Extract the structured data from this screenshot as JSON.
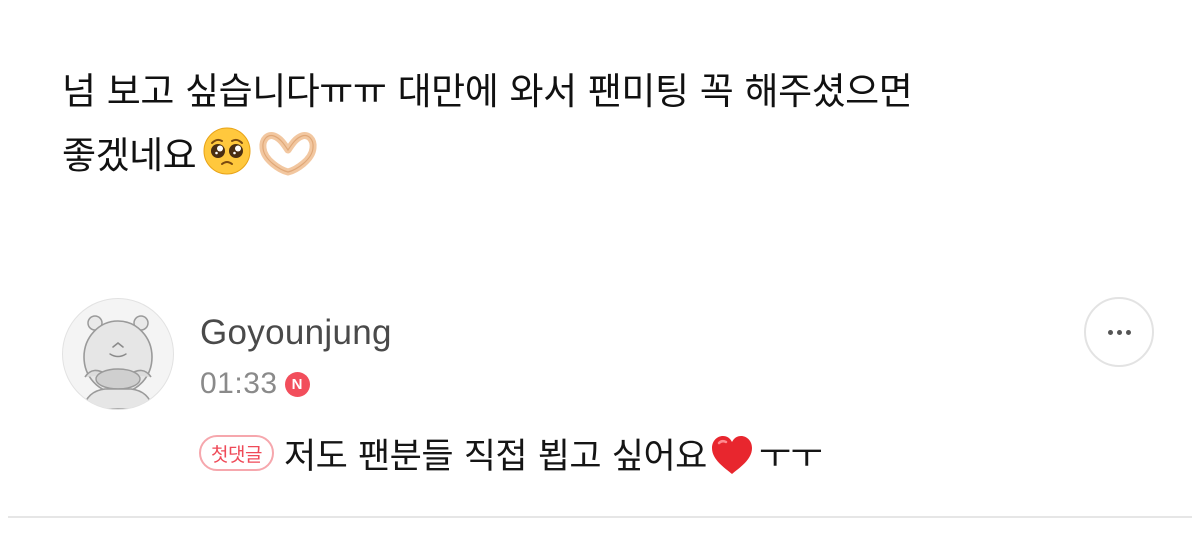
{
  "post": {
    "line1": "넘 보고 싶습니다ㅠㅠ 대만에 와서 팬미팅 꼭 해주셨으면",
    "line2": "좋겠네요",
    "emojis": [
      "pleading-face",
      "heart-hands"
    ]
  },
  "comment": {
    "author": "Goyounjung",
    "time": "01:33",
    "new_badge": "N",
    "first_comment_badge": "첫댓글",
    "text_before_emoji": "저도 팬분들 직접 뵙고 싶어요",
    "text_after_emoji": "ㅜㅜ",
    "emoji": "red-heart"
  },
  "actions": {
    "more_icon": "more-horizontal-icon"
  },
  "colors": {
    "accent": "#f24e5c",
    "badge_border": "#f6a7ad",
    "time_gray": "#8a8a8a",
    "divider": "#e6e6e6"
  }
}
